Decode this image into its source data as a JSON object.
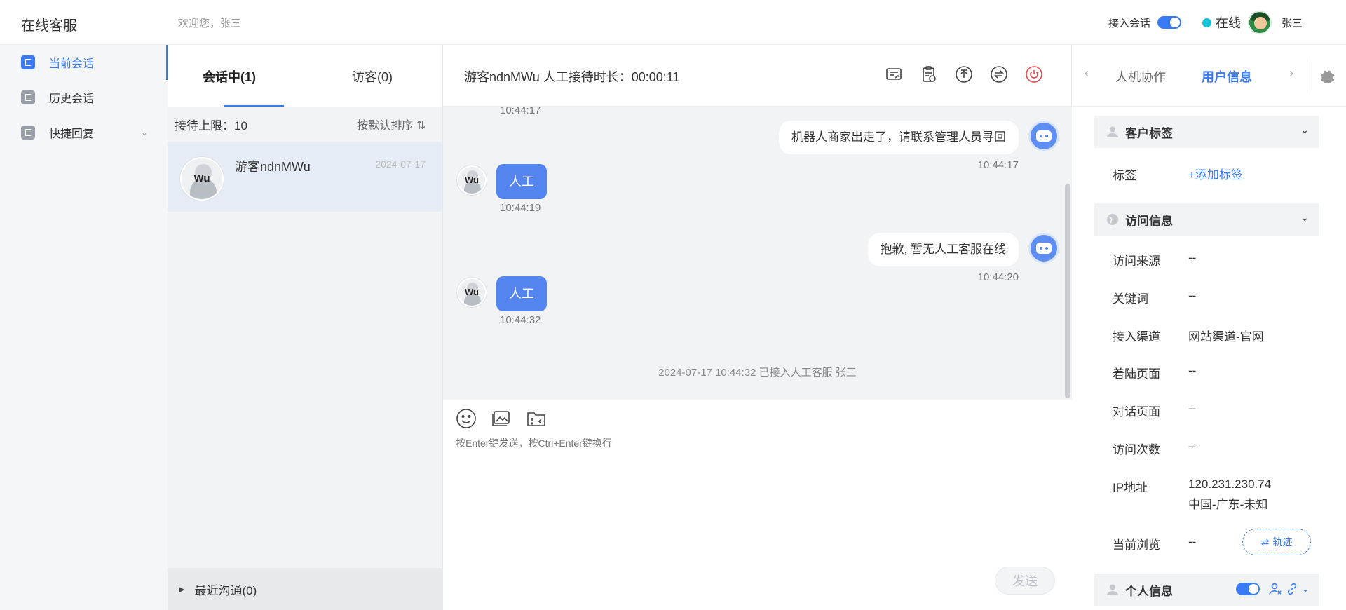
{
  "header": {
    "brand": "在线客服",
    "welcome": "欢迎您，张三",
    "accept_label": "接入会话",
    "status": "在线",
    "agent_name": "张三"
  },
  "sidebar": {
    "items": [
      {
        "label": "当前会话",
        "icon": "chat-icon",
        "active": true
      },
      {
        "label": "历史会话",
        "icon": "history-icon",
        "active": false
      },
      {
        "label": "快捷回复",
        "icon": "quick-reply-icon",
        "active": false
      }
    ]
  },
  "conversations": {
    "tabs": [
      "会话中(1)",
      "访客(0)"
    ],
    "limit_label": "接待上限：10",
    "sort_label": "按默认排序",
    "items": [
      {
        "name": "游客ndnMWu",
        "date": "2024-07-17",
        "avatar_text": "Wu"
      }
    ],
    "recent_label": "最近沟通(0)"
  },
  "chat": {
    "title": "游客ndnMWu 人工接待时长：00:00:11",
    "messages": [
      {
        "time": "10:44:17"
      },
      {
        "side": "right",
        "text": "机器人商家出走了，请联系管理人员寻回",
        "time": "10:44:17"
      },
      {
        "side": "left",
        "text": "人工",
        "time": "10:44:19",
        "avatar_text": "Wu"
      },
      {
        "side": "right",
        "text": "抱歉, 暂无人工客服在线",
        "time": "10:44:20"
      },
      {
        "side": "left",
        "text": "人工",
        "time": "10:44:32",
        "avatar_text": "Wu"
      }
    ],
    "system_note": "2024-07-17 10:44:32 已接入人工客服 张三",
    "input_placeholder": "按Enter键发送，按Ctrl+Enter键换行",
    "send_label": "发送",
    "accent_color": "#5485ef"
  },
  "info": {
    "tabs": [
      "人机协作",
      "用户信息"
    ],
    "sections": {
      "customer_tags": "客户标签",
      "visit_info": "访问信息",
      "personal_info": "个人信息"
    },
    "tag_label": "标签",
    "add_tag": "+添加标签",
    "fields": [
      {
        "label": "访问来源",
        "value": "--"
      },
      {
        "label": "关键词",
        "value": "--"
      },
      {
        "label": "接入渠道",
        "value": "网站渠道-官网"
      },
      {
        "label": "着陆页面",
        "value": "--"
      },
      {
        "label": "对话页面",
        "value": "--"
      },
      {
        "label": "访问次数",
        "value": "--"
      },
      {
        "label": "IP地址",
        "value": "120.231.230.74",
        "value2": "中国-广东-未知"
      },
      {
        "label": "当前浏览",
        "value": "--"
      }
    ],
    "track_label": "轨迹"
  }
}
